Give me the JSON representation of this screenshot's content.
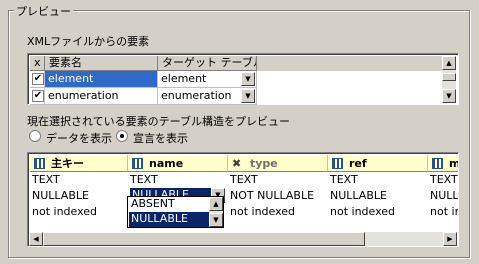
{
  "group": {
    "title": "プレビュー"
  },
  "xml_section": {
    "label": "XMLファイルからの要素",
    "columns": [
      "x",
      "要素名",
      "ターゲット テーブル"
    ],
    "rows": [
      {
        "checked": "✔",
        "name": "element",
        "target": "element",
        "selected": true
      },
      {
        "checked": "✔",
        "name": "enumeration",
        "target": "enumeration",
        "selected": false
      }
    ]
  },
  "preview_section": {
    "label": "現在選択されている要素のテーブル構造をプレビュー",
    "radio_data": "データを表示",
    "radio_decl": "宣言を表示",
    "columns": [
      {
        "name": "主キー",
        "icon": "column-icon"
      },
      {
        "name": "name",
        "icon": "column-icon"
      },
      {
        "name": "type",
        "icon": "excluded-x-icon"
      },
      {
        "name": "ref",
        "icon": "column-icon"
      },
      {
        "name": "m",
        "icon": "column-icon"
      }
    ],
    "rows": [
      [
        "TEXT",
        "TEXT",
        "TEXT",
        "TEXT",
        "TEXT"
      ],
      [
        "NULLABLE",
        "NULLABLE",
        "NOT NULLABLE",
        "NULLABLE",
        "NULLA"
      ],
      [
        "not indexed",
        "",
        "not indexed",
        "not indexed",
        "not in"
      ]
    ],
    "dropdown_options": [
      "ABSENT",
      "NULLABLE"
    ],
    "dropdown_selected": "NULLABLE"
  },
  "glyphs": {
    "down": "▼",
    "up": "▲",
    "left": "◀",
    "right": "▶",
    "x": "✖"
  },
  "colors": {
    "selection": "#3169c6",
    "header_bg": "#ffffcc",
    "dialog_bg": "#d4d0c8"
  }
}
